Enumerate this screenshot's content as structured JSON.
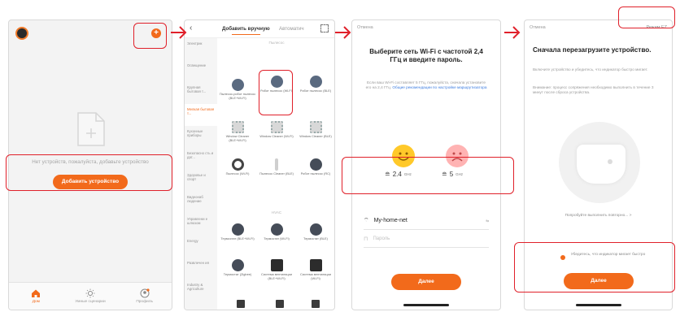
{
  "colors": {
    "accent": "#f26a1b",
    "highlight": "#e0202a",
    "link": "#3d7de0"
  },
  "screen1": {
    "empty_text": "Нет устройств, пожалуйста, добавьте устройство",
    "add_button": "Добавить устройство",
    "tabs": [
      {
        "label": "Дом",
        "icon": "home-icon",
        "active": true
      },
      {
        "label": "Умные сценарии",
        "icon": "sun-icon",
        "active": false
      },
      {
        "label": "Профиль",
        "icon": "profile-icon",
        "active": false
      }
    ]
  },
  "screen2": {
    "tab_manual": "Добавить вручную",
    "tab_auto": "Автоматич",
    "categories": [
      "Электрик",
      "Освещение",
      "Крупная бытовая т...",
      "Мелкая бытовая т...",
      "Кухонные приборы",
      "Безопасно сть и дат...",
      "Здоровье и спорт",
      "Видеонаб людение",
      "Управлени е шлюзом",
      "Energy",
      "Развлечен ия",
      "Industry & Agriculture"
    ],
    "group_cleaner": "Пылесос",
    "group_hvac": "HVAC",
    "devices": [
      {
        "name": "Пылесос-робот пылесос (BLE+Wi-Fi)"
      },
      {
        "name": "Робот пылесос (Wi-Fi)"
      },
      {
        "name": "Робот пылесос (BLE)"
      },
      {
        "name": "Window Cleaner (BLE+Wi-Fi)"
      },
      {
        "name": "Window Cleaner (Wi-Fi)"
      },
      {
        "name": "Window Cleaner (BLE)"
      },
      {
        "name": "Пылесос (Wi-Fi)"
      },
      {
        "name": "Пылесос Cleaner (BLE)"
      },
      {
        "name": "Робот пылесос (RC)"
      },
      {
        "name": "Термостат (BLE+Wi-Fi)"
      },
      {
        "name": "Термостат (Wi-Fi)"
      },
      {
        "name": "Термостат (BLE)"
      },
      {
        "name": "Термостат (Zigbee)"
      },
      {
        "name": "Система вентиляции (BLE+Wi-Fi)"
      },
      {
        "name": "Система вентиляции (Wi-Fi)"
      }
    ]
  },
  "screen3": {
    "cancel": "Отмена",
    "title": "Выберите сеть Wi-Fi с частотой 2,4 ГГц и введите пароль.",
    "subtitle": "Если ваш Wi-Fi составляет 5 ГГц, пожалуйста, сначала установите его на 2,4 ГГц.",
    "link": "Общие рекомендации по настройке маршрутизатора",
    "band_good": "2.4",
    "band_good_unit": "GHz",
    "band_bad": "5",
    "band_bad_unit": "GHz",
    "ssid": "My-home-net",
    "switch_label": "⇆",
    "password_placeholder": "Пароль",
    "next": "Далее"
  },
  "screen4": {
    "cancel": "Отмена",
    "mode": "Режим EZ",
    "title": "Сначала перезагрузите устройство.",
    "desc": "Включите устройство и убедитесь, что индикатор быстро мигает.",
    "warning": "Внимание: процесс сопряжения необходимо выполнить в течение 3 минут после сброса устройства.",
    "try_link": "Попробуйте выполнить повторно... >",
    "confirm": "Убедитесь, что индикатор мигает быстро",
    "next": "Далее"
  }
}
